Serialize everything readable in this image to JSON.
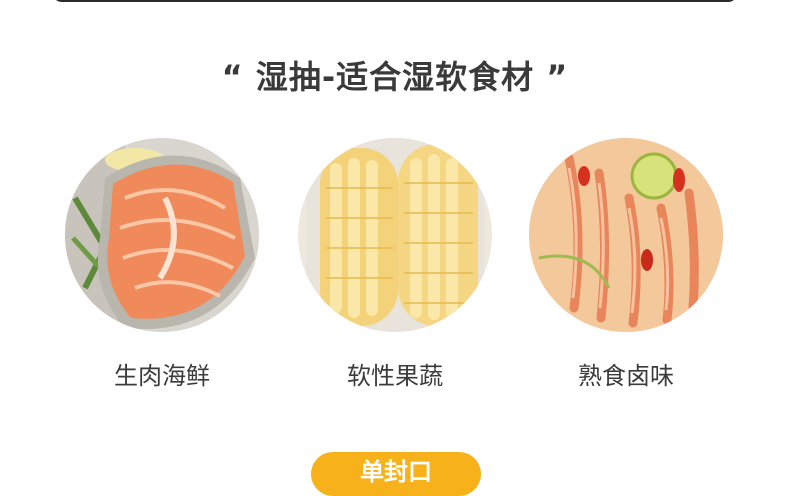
{
  "section": {
    "title": "“ 湿抽-适合湿软食材 ”"
  },
  "items": [
    {
      "label": "生肉海鲜",
      "image": "salmon-steak-photo"
    },
    {
      "label": "软性果蔬",
      "image": "sweet-corn-photo"
    },
    {
      "label": "熟食卤味",
      "image": "marinated-shrimp-photo"
    }
  ],
  "next_button": {
    "label": "单封口"
  },
  "colors": {
    "accent": "#f7b21b",
    "title_text": "#3a3a3a",
    "label_text": "#3b3b3b",
    "top_bar": "#2b2b2b"
  }
}
